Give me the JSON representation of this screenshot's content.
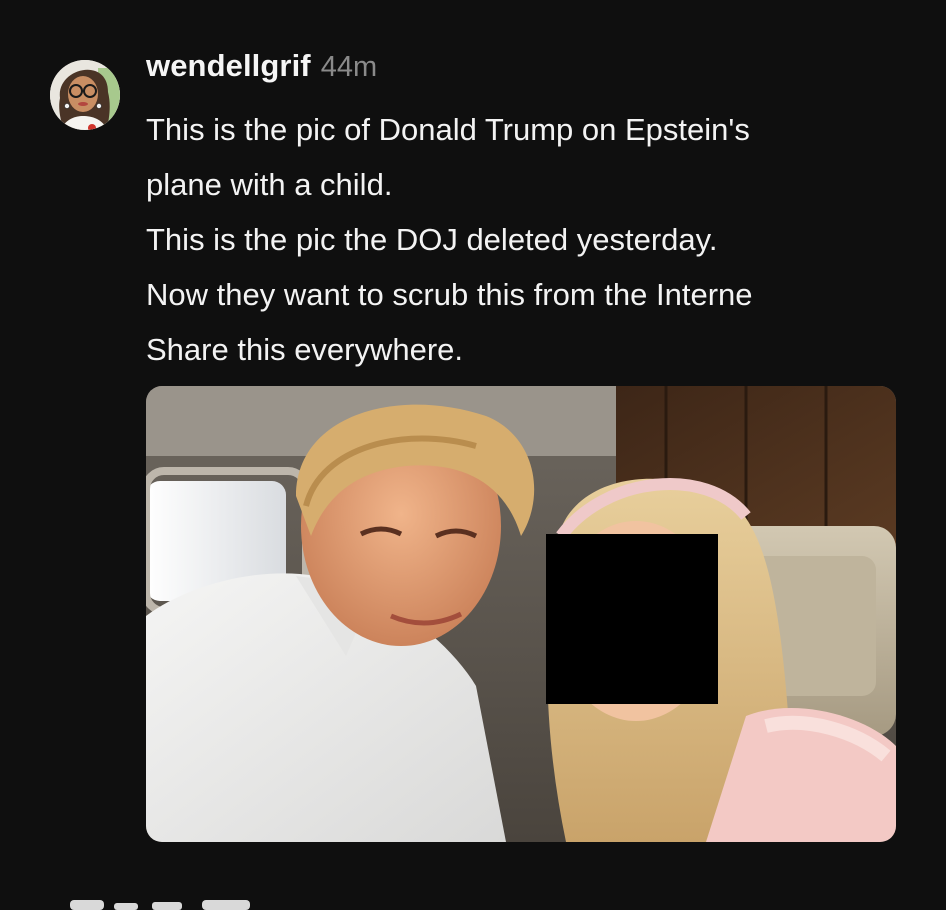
{
  "post": {
    "username": "wendellgrif",
    "timestamp": "44m",
    "lines": [
      "This is the pic of Donald Trump on Epstein's",
      "plane with a child.",
      "This is the pic the DOJ deleted yesterday.",
      "Now they want to scrub this from the Interne",
      "Share this everywhere."
    ]
  },
  "colors": {
    "background": "#0f0f0f",
    "username": "#f5f5f5",
    "timestamp": "#8a8a8a",
    "censor_box": "#000000"
  },
  "icons": {
    "avatar": "cartoon-woman-avatar",
    "censor": "black-censor-square"
  }
}
